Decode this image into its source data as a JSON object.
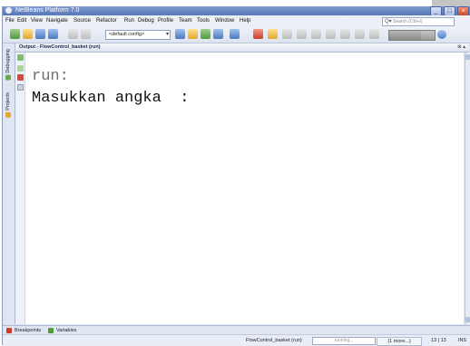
{
  "window": {
    "title": "NetBeans Platform 7.0",
    "minimize_glyph": "_",
    "maximize_glyph": "□",
    "close_glyph": "×"
  },
  "menu": {
    "items": [
      "File",
      "Edit",
      "View",
      "Navigate",
      "Source",
      "Refactor",
      "Run",
      "Debug",
      "Profile",
      "Team",
      "Tools",
      "Window",
      "Help"
    ]
  },
  "search": {
    "icon_glyph": "Q▾",
    "placeholder": "Search (Ctrl+I)"
  },
  "toolbar": {
    "config_value": "<default config>",
    "config_arrow": "▾",
    "memory_fraction": 0.7
  },
  "left_strip": {
    "tabs": [
      "Debugging",
      "Projects"
    ]
  },
  "output": {
    "title": "Output - FlowControl_basket (run)",
    "controls": "⊗ ▴",
    "lines": [
      "run:",
      "Masukkan angka  :"
    ]
  },
  "bottom_tabs": [
    "Breakpoints",
    "Variables"
  ],
  "status": {
    "project": "FlowControl_basket (run)",
    "progress_label": "running...",
    "more": "(1 more...)",
    "position": "13 | 13",
    "mode": "INS"
  },
  "colors": {
    "titlebar": "#5677b8",
    "accent_green": "#4f9b3a",
    "accent_red": "#cc3b2b"
  }
}
